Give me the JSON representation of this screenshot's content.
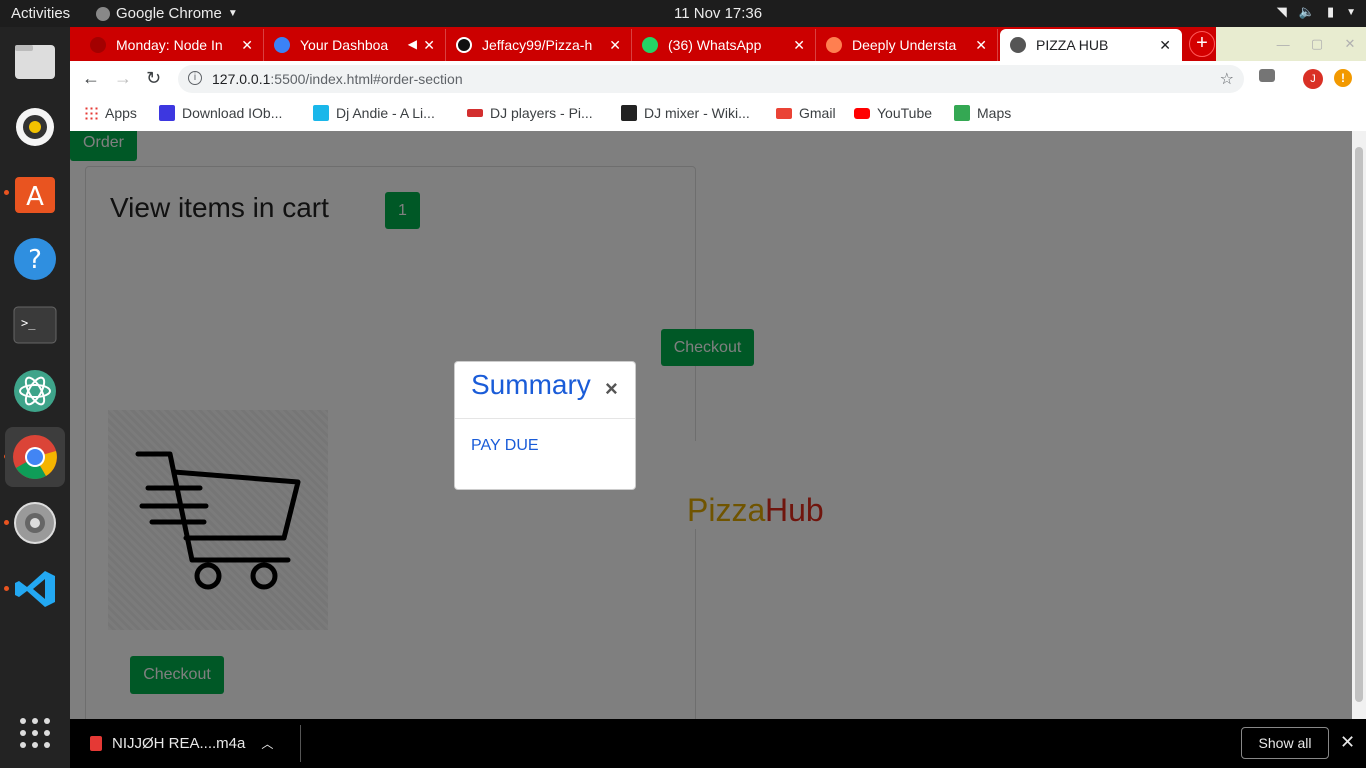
{
  "topbar": {
    "activities": "Activities",
    "app_name": "Google Chrome",
    "datetime": "11 Nov  17:36"
  },
  "browser": {
    "tabs": [
      {
        "title": "Monday: Node In",
        "active": false,
        "favicon_color": "#a30000"
      },
      {
        "title": "Your Dashboa",
        "active": false,
        "favicon_color": "#3b82f6"
      },
      {
        "title": "Jeffacy99/Pizza-h",
        "active": false,
        "favicon_color": "#111111"
      },
      {
        "title": "(36) WhatsApp",
        "active": false,
        "favicon_color": "#25d366"
      },
      {
        "title": "Deeply Understa",
        "active": false,
        "favicon_color": "#ff7f50"
      },
      {
        "title": "PIZZA HUB",
        "active": true,
        "favicon_color": "#555555"
      }
    ],
    "url_host": "127.0.0.1",
    "url_path": ":5500/index.html#order-section",
    "bookmarks": [
      {
        "label": "Apps",
        "icon_color": "#e53935"
      },
      {
        "label": "Download IOb...",
        "icon_color": "#3d37e0"
      },
      {
        "label": "Dj Andie - A Li...",
        "icon_color": "#1ab7ea"
      },
      {
        "label": "DJ players - Pi...",
        "icon_color": "#d32f2f"
      },
      {
        "label": "DJ mixer - Wiki...",
        "icon_color": "#222222"
      },
      {
        "label": "Gmail",
        "icon_color": "#ea4335"
      },
      {
        "label": "YouTube",
        "icon_color": "#ff0000"
      },
      {
        "label": "Maps",
        "icon_color": "#34a853"
      }
    ],
    "profile_initial": "J"
  },
  "page": {
    "order_button": "Order",
    "cart_title": "View items in cart",
    "cart_count": "1",
    "checkout_top": "Checkout",
    "checkout_bottom": "Checkout",
    "logo_part1": "Pizza",
    "logo_part2": "Hub"
  },
  "modal": {
    "title": "Summary",
    "close": "×",
    "body": "PAY DUE"
  },
  "downloads": {
    "file_name": "NIJJØH REA....m4a",
    "show_all": "Show all"
  },
  "colors": {
    "brand_green": "#00b04c",
    "chrome_red": "#cc0000",
    "modal_blue": "#1a5cd8"
  }
}
